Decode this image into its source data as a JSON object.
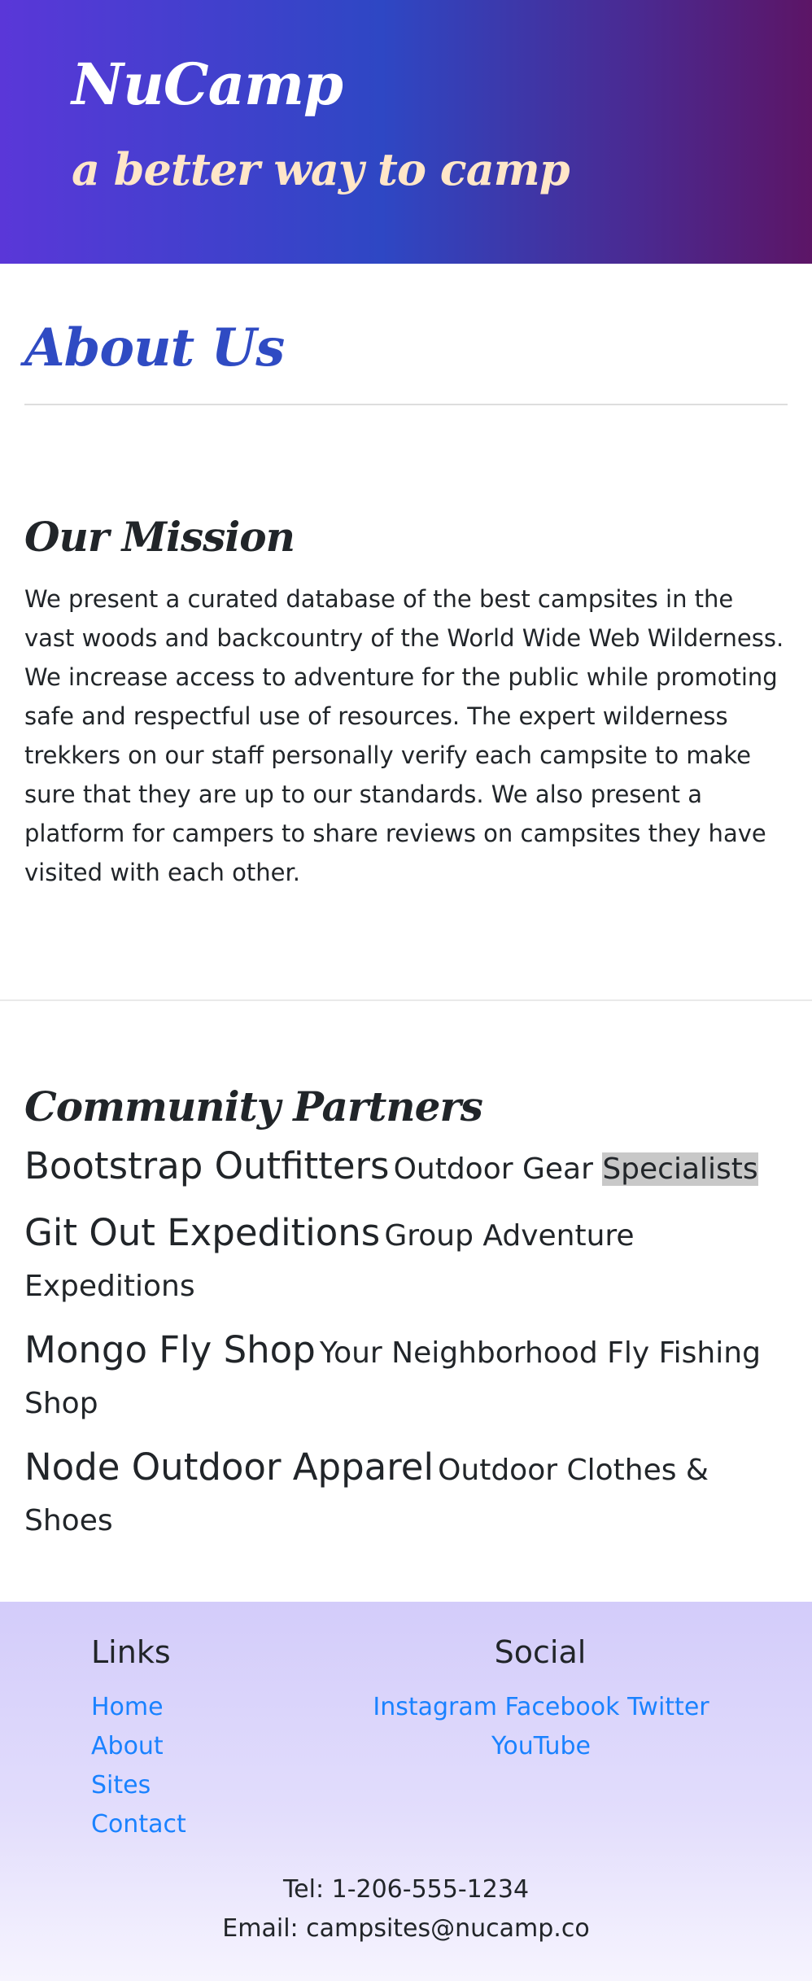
{
  "header": {
    "brand": "NuCamp",
    "tagline": "a better way to camp"
  },
  "page": {
    "title": "About Us"
  },
  "mission": {
    "heading": "Our Mission",
    "text": "We present a curated database of the best campsites in the vast woods and backcountry of the World Wide Web Wilderness. We increase access to adventure for the public while promoting safe and respectful use of resources. The expert wilderness trekkers on our staff personally verify each campsite to make sure that they are up to our standards. We also present a platform for campers to share reviews on campsites they have visited with each other."
  },
  "partners": {
    "heading": "Community Partners",
    "items": [
      {
        "name": "Bootstrap Outfitters",
        "desc_pre": "Outdoor Gear ",
        "desc_highlight": "Specialists"
      },
      {
        "name": "Git Out Expeditions",
        "desc": "Group Adventure Expeditions"
      },
      {
        "name": "Mongo Fly Shop",
        "desc": "Your Neighborhood Fly Fishing Shop"
      },
      {
        "name": "Node Outdoor Apparel",
        "desc": "Outdoor Clothes & Shoes"
      }
    ]
  },
  "footer": {
    "links_heading": "Links",
    "links": [
      "Home",
      "About",
      "Sites",
      "Contact"
    ],
    "social_heading": "Social",
    "social": [
      "Instagram",
      "Facebook",
      "Twitter",
      "YouTube"
    ],
    "tel": "Tel: 1-206-555-1234",
    "email": "Email: campsites@nucamp.co"
  },
  "colors": {
    "header_gradient_start": "#5a37d8",
    "header_gradient_end": "#5c1566",
    "title_blue": "#2f4bc3",
    "tagline_cream": "#ffe6c8",
    "link_blue": "#1a82ff",
    "footer_lavender": "#d3ccfa"
  }
}
